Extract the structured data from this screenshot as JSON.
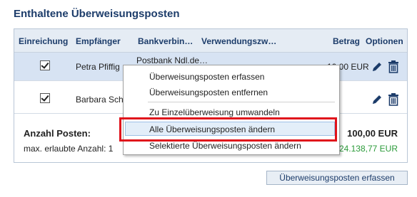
{
  "title": "Enthaltene Überweisungsposten",
  "table": {
    "headers": {
      "einreichung": "Einreichung",
      "empfaenger": "Empfänger",
      "bankverbindung": "Bankverbin…",
      "verwendungszweck": "Verwendungszw…",
      "betrag": "Betrag",
      "optionen": "Optionen"
    },
    "rows": [
      {
        "checked": true,
        "empfaenger": "Petra Pfiffig",
        "bank": "Postbank Ndl.de…",
        "betrag": "10,00 EUR",
        "selected": true
      },
      {
        "checked": true,
        "empfaenger": "Barbara Sch",
        "bank": "",
        "betrag": "",
        "selected": false
      }
    ]
  },
  "summary": {
    "count_label": "Anzahl Posten:",
    "max_label": "max. erlaubte Anzahl: 1",
    "total": "100,00 EUR",
    "max_value": "24.138,77 EUR"
  },
  "add_button": "Überweisungsposten erfassen",
  "context_menu": {
    "items": [
      "Überweisungsposten erfassen",
      "Überweisungsposten entfernen",
      "Zu Einzelüberweisung umwandeln",
      "Alle Überweisungsposten ändern",
      "Selektierte Überweisungsposten ändern"
    ],
    "highlighted_index": 3
  },
  "colors": {
    "accent": "#1c3c6a",
    "highlight": "#e0121b",
    "positive": "#2b9b3a"
  },
  "icons": {
    "edit": "pencil-icon",
    "delete": "trash-icon"
  }
}
